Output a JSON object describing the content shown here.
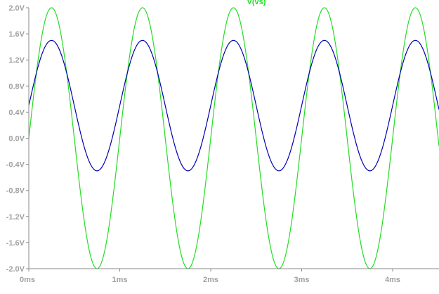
{
  "chart_data": {
    "type": "line",
    "title": "V(vs)",
    "xlabel": "",
    "ylabel": "",
    "x_unit": "ms",
    "y_unit": "V",
    "xlim": [
      0,
      4.5
    ],
    "ylim": [
      -2.0,
      2.0
    ],
    "grid": false,
    "x_ticks": [
      0,
      1,
      2,
      3,
      4
    ],
    "x_tick_labels": [
      "0ms",
      "1ms",
      "2ms",
      "3ms",
      "4ms"
    ],
    "y_ticks": [
      2.0,
      1.6,
      1.2,
      0.8,
      0.4,
      0.0,
      -0.4,
      -0.8,
      -1.2,
      -1.6,
      -2.0
    ],
    "y_tick_labels": [
      "2.0V",
      "1.6V",
      "1.2V",
      "0.8V",
      "0.4V",
      "0.0V",
      "-0.4V",
      "-0.8V",
      "-1.2V",
      "-1.6V",
      "-2.0V"
    ],
    "series": [
      {
        "name": "V(vs)",
        "color": "#22dd22",
        "shape": "sine",
        "frequency_hz": 1000,
        "amplitude": 2.0,
        "offset": 0.0,
        "phase_deg": 0
      },
      {
        "name": "",
        "color": "#0000b0",
        "shape": "sine",
        "frequency_hz": 1000,
        "amplitude": 1.0,
        "offset": 0.5,
        "phase_deg": 0
      }
    ]
  },
  "colors": {
    "background": "#ffffff",
    "axis": "#888888",
    "tick_label": "#a0a0a0",
    "title": "#22dd22"
  }
}
